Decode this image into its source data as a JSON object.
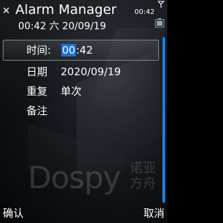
{
  "status": {
    "close_icon": "✕",
    "title": "Alarm Manager",
    "subtitle": "00:42 六 20/09/19",
    "clock": "00:42",
    "signal_icon": "signal-antenna-icon",
    "battery_icon": "battery-icon"
  },
  "form": {
    "time": {
      "label": "时间:",
      "value_selected": "00",
      "value_rest": ":42"
    },
    "date": {
      "label": "日期",
      "value": "2020/09/19"
    },
    "repeat": {
      "label": "重复",
      "value": "单次"
    },
    "note": {
      "label": "备注",
      "value": ""
    }
  },
  "watermark": {
    "latin": "Dospy",
    "cjk": "诺亚方舟"
  },
  "softkeys": {
    "left": "确认",
    "right": "取消"
  },
  "colors": {
    "selection": "#1b6fd8",
    "scrollbar": "#1e7fe6",
    "background": "#101216"
  }
}
